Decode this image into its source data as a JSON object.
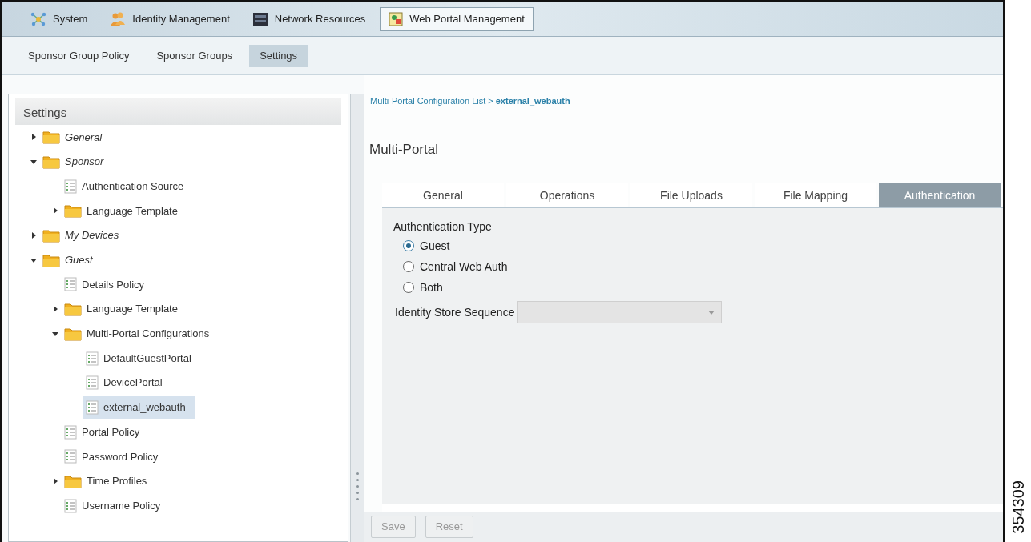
{
  "top_tabs": [
    {
      "label": "System",
      "kind": "network",
      "selected": false
    },
    {
      "label": "Identity Management",
      "kind": "people",
      "selected": false
    },
    {
      "label": "Network Resources",
      "kind": "server",
      "selected": false
    },
    {
      "label": "Web Portal Management",
      "kind": "portal",
      "selected": true
    }
  ],
  "sub_tabs": [
    {
      "label": "Sponsor Group Policy",
      "selected": false
    },
    {
      "label": "Sponsor Groups",
      "selected": false
    },
    {
      "label": "Settings",
      "selected": true
    }
  ],
  "sidebar": {
    "title": "Settings",
    "items": [
      {
        "label": "General",
        "kind": "folder",
        "expanded": false,
        "selected": false
      },
      {
        "label": "Sponsor",
        "kind": "folder",
        "expanded": true,
        "selected": false,
        "children": [
          {
            "label": "Authentication Source",
            "kind": "page",
            "selected": false
          },
          {
            "label": "Language Template",
            "kind": "folder",
            "expanded": false,
            "selected": false
          }
        ]
      },
      {
        "label": "My Devices",
        "kind": "folder",
        "expanded": false,
        "selected": false
      },
      {
        "label": "Guest",
        "kind": "folder",
        "expanded": true,
        "selected": false,
        "children": [
          {
            "label": "Details Policy",
            "kind": "page",
            "selected": false
          },
          {
            "label": "Language Template",
            "kind": "folder",
            "expanded": false,
            "selected": false
          },
          {
            "label": "Multi-Portal Configurations",
            "kind": "folder",
            "expanded": true,
            "selected": false,
            "children": [
              {
                "label": "DefaultGuestPortal",
                "kind": "page",
                "selected": false
              },
              {
                "label": "DevicePortal",
                "kind": "page",
                "selected": false
              },
              {
                "label": "external_webauth",
                "kind": "page",
                "selected": true
              }
            ]
          },
          {
            "label": "Portal Policy",
            "kind": "page",
            "selected": false
          },
          {
            "label": "Password Policy",
            "kind": "page",
            "selected": false
          },
          {
            "label": "Time Profiles",
            "kind": "folder",
            "expanded": false,
            "selected": false
          },
          {
            "label": "Username Policy",
            "kind": "page",
            "selected": false
          }
        ]
      }
    ]
  },
  "breadcrumb": {
    "link": "Multi-Portal Configuration List",
    "separator": ">",
    "current": "external_webauth"
  },
  "page_title": "Multi-Portal",
  "tabs": [
    {
      "label": "General",
      "selected": false
    },
    {
      "label": "Operations",
      "selected": false
    },
    {
      "label": "File Uploads",
      "selected": false
    },
    {
      "label": "File Mapping",
      "selected": false
    },
    {
      "label": "Authentication",
      "selected": true
    }
  ],
  "form": {
    "group_label": "Authentication Type",
    "options": [
      {
        "label": "Guest",
        "selected": true
      },
      {
        "label": "Central Web Auth",
        "selected": false
      },
      {
        "label": "Both",
        "selected": false
      }
    ],
    "select_label": "Identity Store Sequence",
    "select_disabled": true
  },
  "buttons": [
    {
      "label": "Save",
      "disabled": true
    },
    {
      "label": "Reset",
      "disabled": true
    }
  ],
  "figure_number": "354309"
}
